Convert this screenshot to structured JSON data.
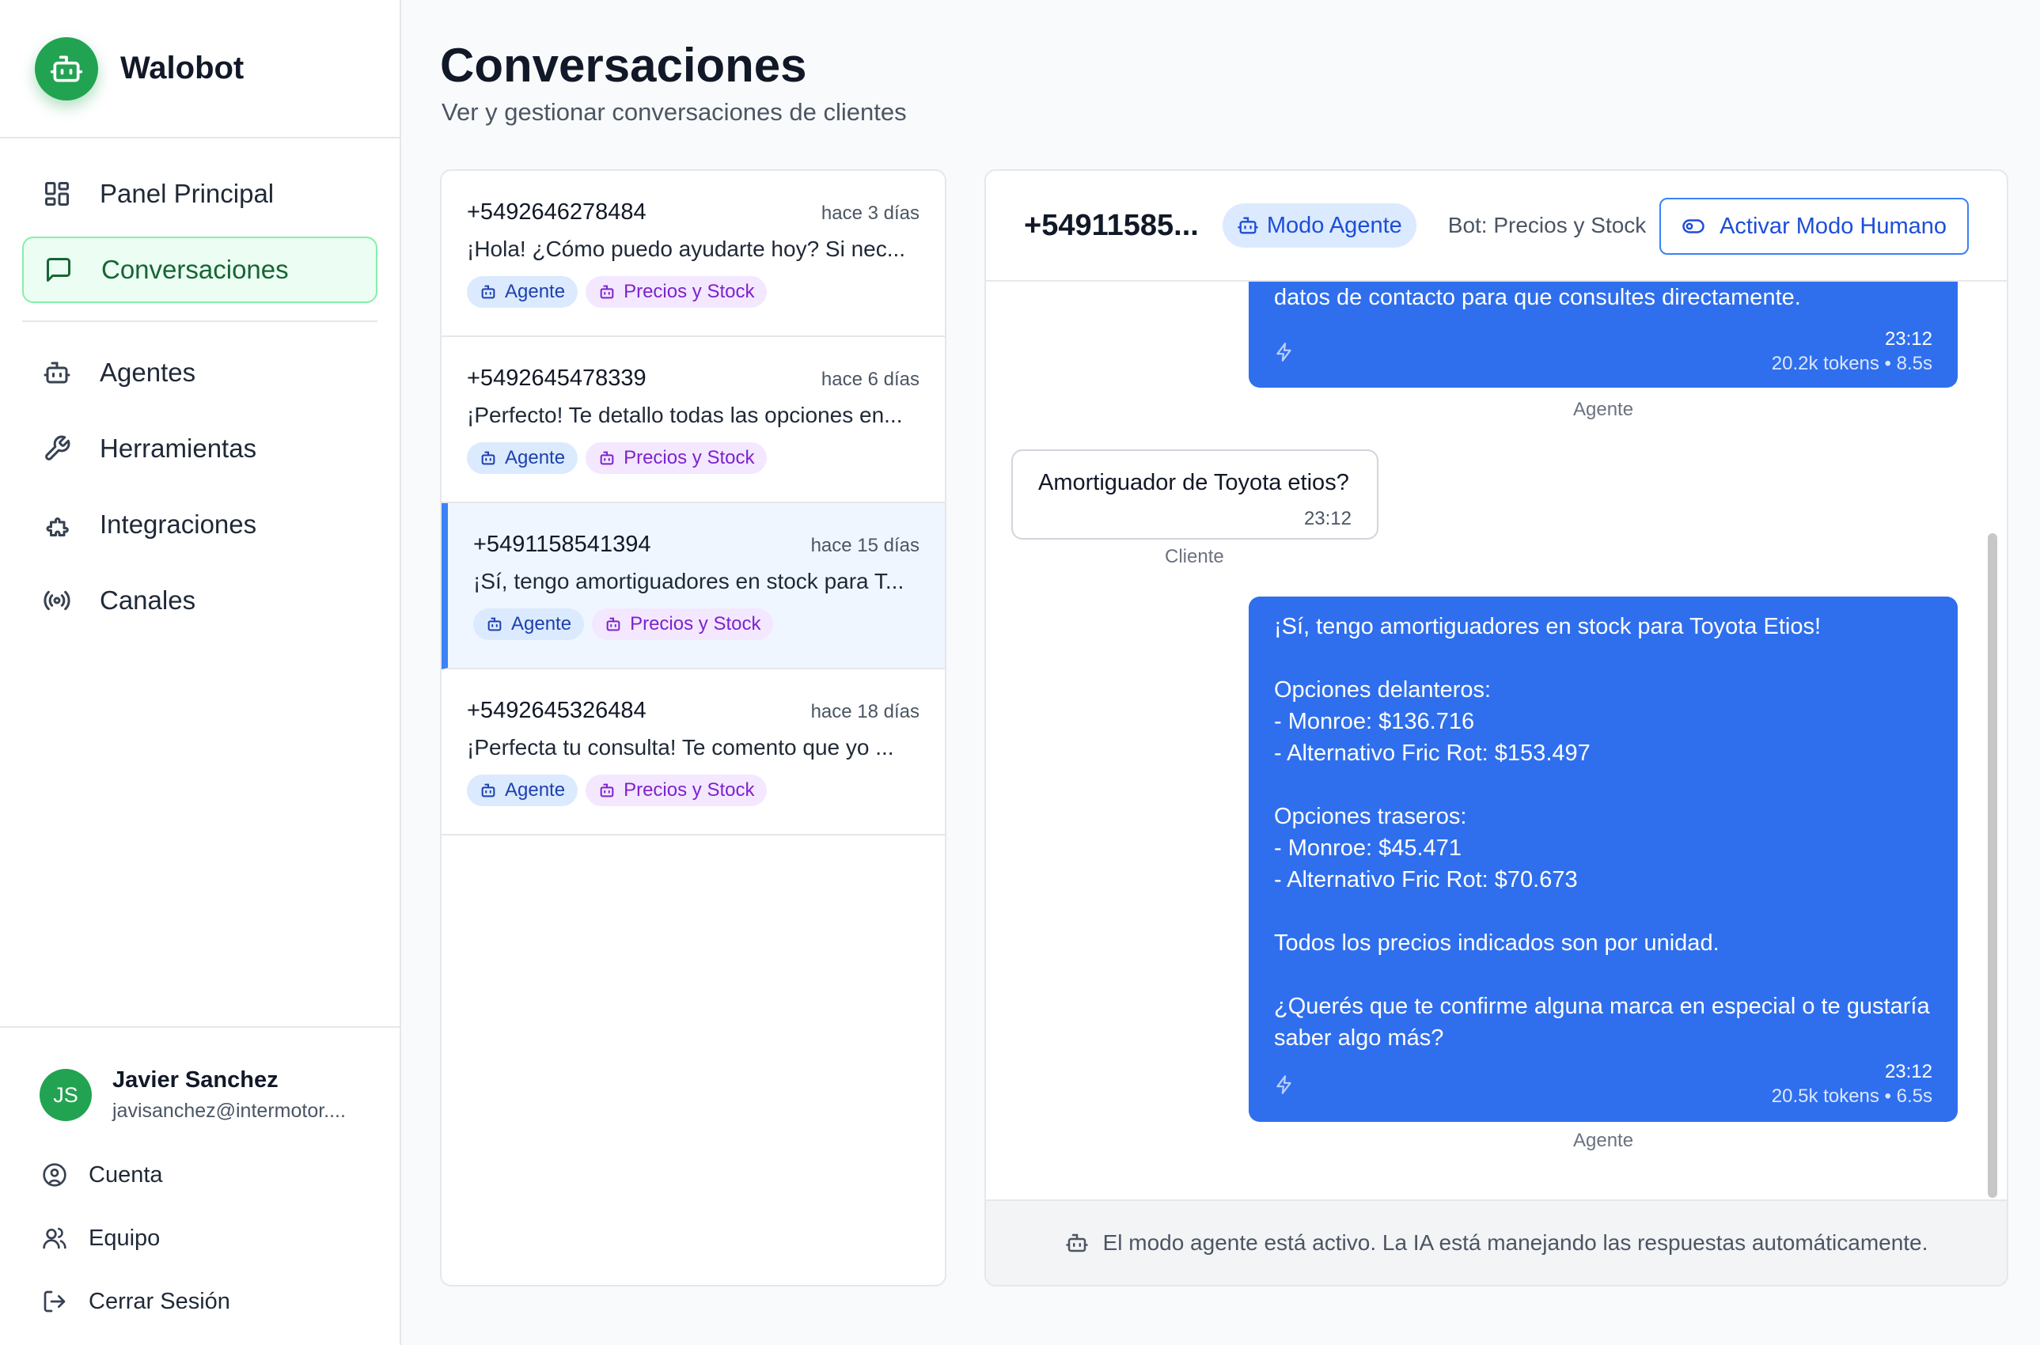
{
  "app": {
    "name": "Walobot"
  },
  "sidebar": {
    "primary": [
      {
        "label": "Panel Principal",
        "icon": "grid-icon"
      },
      {
        "label": "Conversaciones",
        "icon": "chat-icon",
        "active": true
      }
    ],
    "secondary": [
      {
        "label": "Agentes",
        "icon": "robot-icon"
      },
      {
        "label": "Herramientas",
        "icon": "wrench-icon"
      },
      {
        "label": "Integraciones",
        "icon": "puzzle-icon"
      },
      {
        "label": "Canales",
        "icon": "broadcast-icon"
      }
    ],
    "user": {
      "initials": "JS",
      "name": "Javier Sanchez",
      "email": "javisanchez@intermotor...."
    },
    "user_links": [
      {
        "label": "Cuenta",
        "icon": "user-circle-icon"
      },
      {
        "label": "Equipo",
        "icon": "users-icon"
      },
      {
        "label": "Cerrar Sesión",
        "icon": "logout-icon"
      }
    ]
  },
  "header": {
    "title": "Conversaciones",
    "subtitle": "Ver y gestionar conversaciones de clientes"
  },
  "conversations": [
    {
      "phone": "+5492646278484",
      "time": "hace 3 días",
      "preview": "¡Hola! ¿Cómo puedo ayudarte hoy? Si nec...",
      "tag_agent": "Agente",
      "tag_bot": "Precios y Stock"
    },
    {
      "phone": "+5492645478339",
      "time": "hace 6 días",
      "preview": "¡Perfecto! Te detallo todas las opciones en...",
      "tag_agent": "Agente",
      "tag_bot": "Precios y Stock"
    },
    {
      "phone": "+5491158541394",
      "time": "hace 15 días",
      "preview": "¡Sí, tengo amortiguadores en stock para T...",
      "tag_agent": "Agente",
      "tag_bot": "Precios y Stock",
      "selected": true
    },
    {
      "phone": "+5492645326484",
      "time": "hace 18 días",
      "preview": "¡Perfecta tu consulta! Te comento que yo ...",
      "tag_agent": "Agente",
      "tag_bot": "Precios y Stock"
    }
  ],
  "chat": {
    "phone": "+54911585...",
    "mode": "Modo Agente",
    "bot": "Bot: Precios y Stock",
    "human_button": "Activar Modo Humano",
    "messages": {
      "m1": {
        "text": "datos de contacto para que consultes directamente.",
        "time": "23:12",
        "tokens": "20.2k tokens • 8.5s",
        "sender": "Agente"
      },
      "m2": {
        "text": "Amortiguador de Toyota etios?",
        "time": "23:12",
        "sender": "Cliente"
      },
      "m3": {
        "lines": [
          "¡Sí, tengo amortiguadores en stock para Toyota Etios!",
          "",
          "Opciones delanteros:",
          "- Monroe: $136.716",
          "- Alternativo Fric Rot: $153.497",
          "",
          "Opciones traseros:",
          "- Monroe: $45.471",
          "- Alternativo Fric Rot: $70.673",
          "",
          "Todos los precios indicados son por unidad.",
          "",
          "¿Querés que te confirme alguna marca en especial o te gustaría",
          "saber algo más?"
        ],
        "time": "23:12",
        "tokens": "20.5k tokens • 6.5s",
        "sender": "Agente"
      }
    },
    "footer": "El modo agente está activo. La IA está manejando las respuestas automáticamente."
  },
  "colors": {
    "brand": "#22a352",
    "accent": "#2f6fed",
    "active_bg": "#ecfdf3",
    "selected_bg": "#eff6ff"
  }
}
